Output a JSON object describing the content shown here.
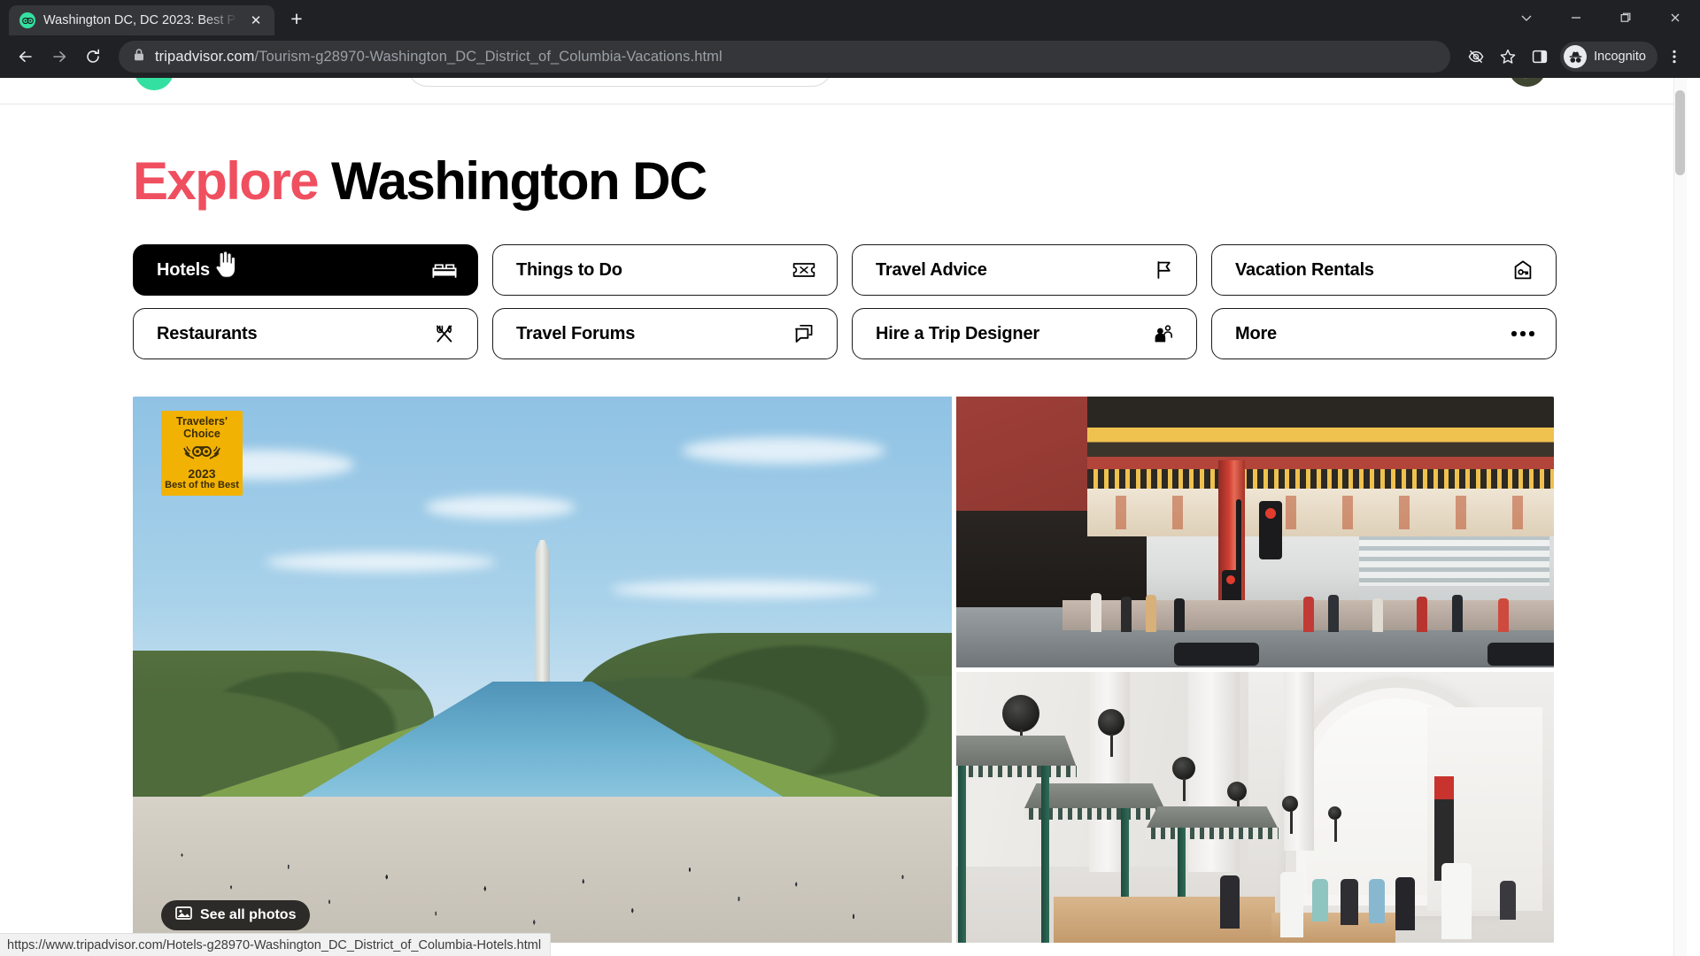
{
  "browser": {
    "tab": {
      "title": "Washington DC, DC 2023: Best P",
      "favicon": "tripadvisor-owl-icon",
      "close_label": "✕"
    },
    "newtab_label": "+",
    "window_controls": [
      "chevron-down-icon",
      "minimize-icon",
      "maximize-icon",
      "close-icon"
    ],
    "nav": {
      "back": "←",
      "forward": "→",
      "reload": "⟳"
    },
    "omnibox": {
      "lock_icon": "lock-icon",
      "domain": "tripadvisor.com",
      "path": "/Tourism-g28970-Washington_DC_District_of_Columbia-Vacations.html"
    },
    "toolbar_icons": [
      "eye-off-icon",
      "star-icon",
      "side-panel-icon"
    ],
    "profile": {
      "label": "Incognito",
      "icon": "incognito-icon"
    },
    "menu_icon": "three-dot-menu-icon",
    "status_link": "https://www.tripadvisor.com/Hotels-g28970-Washington_DC_District_of_Columbia-Hotels.html"
  },
  "page": {
    "title_accent": "Explore",
    "title_rest": "Washington DC",
    "accent_color": "#ef4f5f",
    "nav_buttons": [
      {
        "label": "Hotels",
        "icon": "bed-icon",
        "active": true
      },
      {
        "label": "Things to Do",
        "icon": "ticket-icon",
        "active": false
      },
      {
        "label": "Travel Advice",
        "icon": "flag-icon",
        "active": false
      },
      {
        "label": "Vacation Rentals",
        "icon": "house-key-icon",
        "active": false
      },
      {
        "label": "Restaurants",
        "icon": "cutlery-icon",
        "active": false
      },
      {
        "label": "Travel Forums",
        "icon": "speech-bubble-icon",
        "active": false
      },
      {
        "label": "Hire a Trip Designer",
        "icon": "people-icon",
        "active": false
      },
      {
        "label": "More",
        "icon": "ellipsis-icon",
        "active": false
      }
    ],
    "badge": {
      "line1": "Travelers'",
      "line2": "Choice",
      "year": "2023",
      "line3": "Best of the Best",
      "bg_color": "#f2b203"
    },
    "see_all_photos": "See all photos",
    "photos": [
      {
        "alt": "Washington Monument and Lincoln Memorial Reflecting Pool on the National Mall"
      },
      {
        "alt": "Chinatown Friendship Archway street scene"
      },
      {
        "alt": "Union Station market hall interior with vendor kiosks"
      }
    ]
  }
}
